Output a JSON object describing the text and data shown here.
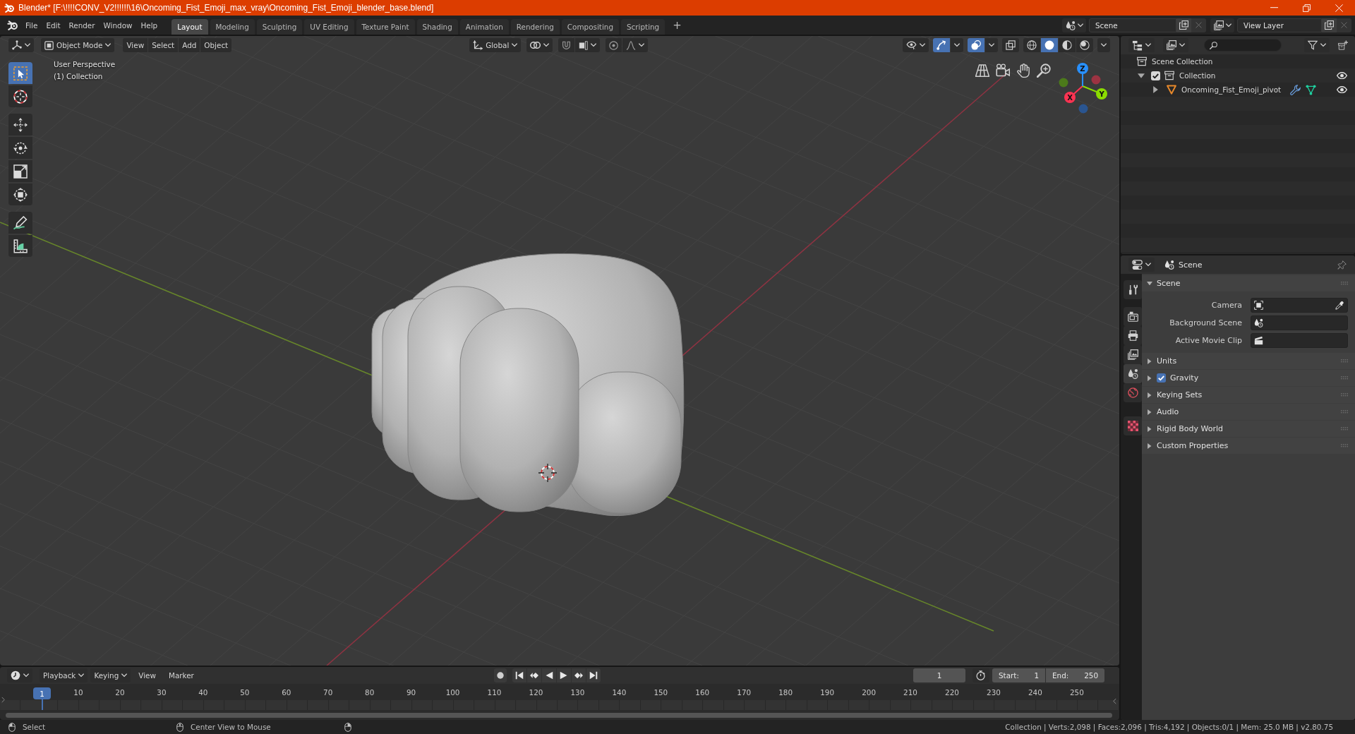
{
  "window": {
    "title": "Blender* [F:\\!!!!CONV_V2!!!!!!\\16\\Oncoming_Fist_Emoji_max_vray\\Oncoming_Fist_Emoji_blender_base.blend]"
  },
  "menu_bar": {
    "menus": [
      "File",
      "Edit",
      "Render",
      "Window",
      "Help"
    ],
    "workspaces": [
      {
        "label": "Layout",
        "selected": true
      },
      {
        "label": "Modeling",
        "selected": false
      },
      {
        "label": "Sculpting",
        "selected": false
      },
      {
        "label": "UV Editing",
        "selected": false
      },
      {
        "label": "Texture Paint",
        "selected": false
      },
      {
        "label": "Shading",
        "selected": false
      },
      {
        "label": "Animation",
        "selected": false
      },
      {
        "label": "Rendering",
        "selected": false
      },
      {
        "label": "Compositing",
        "selected": false
      },
      {
        "label": "Scripting",
        "selected": false
      }
    ],
    "add_workspace": "+",
    "scene": "Scene",
    "view_layer": "View Layer"
  },
  "viewport": {
    "mode": "Object Mode",
    "menus": [
      "View",
      "Select",
      "Add",
      "Object"
    ],
    "orientation": "Global",
    "toggles": [
      {
        "kind": "gizmos",
        "on": true
      },
      {
        "kind": "overlays",
        "on": true
      },
      {
        "kind": "xray",
        "on": false
      }
    ],
    "shading": [
      {
        "kind": "wireframe",
        "selected": false
      },
      {
        "kind": "solid",
        "selected": true
      },
      {
        "kind": "material",
        "selected": false
      },
      {
        "kind": "rendered",
        "selected": false
      }
    ],
    "info": [
      "User Perspective",
      "(1) Collection"
    ],
    "tools": [
      {
        "kind": "select_box",
        "selected": true
      },
      {
        "kind": "cursor",
        "selected": false
      },
      {
        "kind": "move",
        "selected": false
      },
      {
        "kind": "rotate",
        "selected": false
      },
      {
        "kind": "scale",
        "selected": false
      },
      {
        "kind": "transform",
        "selected": false
      },
      {
        "kind": "annotate",
        "selected": false
      },
      {
        "kind": "measure",
        "selected": false
      }
    ],
    "gizmo": [
      {
        "label": "X",
        "color": "#ff3352"
      },
      {
        "label": "Y",
        "color": "#8bdc00"
      },
      {
        "label": "Z",
        "color": "#2890ff"
      }
    ]
  },
  "outliner": {
    "tree": [
      {
        "label": "Scene Collection",
        "kind": "scene_collection",
        "children": [
          {
            "label": "Collection",
            "kind": "collection",
            "expanded": true,
            "checked": true,
            "visible": true,
            "children": [
              {
                "label": "Oncoming_Fist_Emoji_pivot",
                "kind": "mesh_object",
                "expanded": false,
                "visible": true
              }
            ]
          }
        ]
      }
    ]
  },
  "properties": {
    "context": "Scene",
    "tabs": [
      {
        "kind": "tool",
        "selected": false
      },
      {
        "kind": "render",
        "selected": false
      },
      {
        "kind": "output",
        "selected": false
      },
      {
        "kind": "view_layer",
        "selected": false
      },
      {
        "kind": "scene",
        "selected": true
      },
      {
        "kind": "world",
        "selected": false
      },
      {
        "kind": "texture",
        "selected": false
      }
    ],
    "panels": [
      {
        "label": "Scene",
        "expanded": true,
        "fields": [
          {
            "label": "Camera",
            "kind": "camera"
          },
          {
            "label": "Background Scene",
            "kind": "scene"
          },
          {
            "label": "Active Movie Clip",
            "kind": "movie_clip"
          }
        ]
      },
      {
        "label": "Units",
        "expanded": false
      },
      {
        "label": "Gravity",
        "expanded": false,
        "toggle": {
          "checked": true
        }
      },
      {
        "label": "Keying Sets",
        "expanded": false
      },
      {
        "label": "Audio",
        "expanded": false
      },
      {
        "label": "Rigid Body World",
        "expanded": false
      },
      {
        "label": "Custom Properties",
        "expanded": false
      }
    ]
  },
  "timeline": {
    "menus": [
      {
        "label": "Playback",
        "kind": "dropdown"
      },
      {
        "label": "Keying",
        "kind": "dropdown"
      },
      {
        "label": "View",
        "kind": "menu"
      },
      {
        "label": "Marker",
        "kind": "menu"
      }
    ],
    "current_frame": "1",
    "start": {
      "label": "Start:",
      "value": "1"
    },
    "end": {
      "label": "End:",
      "value": "250"
    },
    "playhead": "1",
    "ruler": [
      "10",
      "20",
      "30",
      "40",
      "50",
      "60",
      "70",
      "80",
      "90",
      "100",
      "110",
      "120",
      "130",
      "140",
      "150",
      "160",
      "170",
      "180",
      "190",
      "200",
      "210",
      "220",
      "230",
      "240",
      "250"
    ]
  },
  "status_bar": {
    "hints": [
      {
        "kind": "left_click",
        "label": "Select"
      },
      {
        "kind": "middle_click",
        "label": "Center View to Mouse"
      },
      {
        "kind": "right_click"
      }
    ],
    "stats": "Collection | Verts:2,098 | Faces:2,096 | Tris:4,192 | Objects:0/1 | Mem: 25.0 MB | v2.80.75"
  }
}
